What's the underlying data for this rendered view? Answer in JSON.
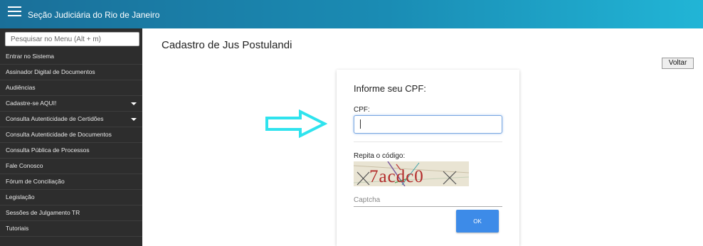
{
  "header": {
    "title": "Seção Judiciária do Rio de Janeiro",
    "menu_icon": "hamburger-icon"
  },
  "sidebar": {
    "search_placeholder": "Pesquisar no Menu (Alt + m)",
    "items": [
      {
        "label": "Entrar no Sistema",
        "has_submenu": false
      },
      {
        "label": "Assinador Digital de Documentos",
        "has_submenu": false
      },
      {
        "label": "Audiências",
        "has_submenu": false
      },
      {
        "label": "Cadastre-se AQUI!",
        "has_submenu": true
      },
      {
        "label": "Consulta Autenticidade de Certidões",
        "has_submenu": true
      },
      {
        "label": "Consulta Autenticidade de Documentos",
        "has_submenu": false
      },
      {
        "label": "Consulta Pública de Processos",
        "has_submenu": false
      },
      {
        "label": "Fale Conosco",
        "has_submenu": false
      },
      {
        "label": "Fórum de Conciliação",
        "has_submenu": false
      },
      {
        "label": "Legislação",
        "has_submenu": false
      },
      {
        "label": "Sessões de Julgamento TR",
        "has_submenu": false
      },
      {
        "label": "Tutoriais",
        "has_submenu": false
      }
    ]
  },
  "main": {
    "title": "Cadastro de Jus Postulandi",
    "back_label": "Voltar",
    "arrow_icon": "right-arrow-icon",
    "arrow_color": "#2fe3ee"
  },
  "form": {
    "heading": "Informe seu CPF:",
    "cpf_label": "CPF:",
    "cpf_value": "",
    "code_label": "Repita o código:",
    "captcha_text": "7acdc0",
    "captcha_placeholder": "Captcha",
    "ok_label": "OK"
  },
  "colors": {
    "header_start": "#1a6f99",
    "header_end": "#21b5d6",
    "sidebar_bg": "#2d2d2d",
    "ok_button": "#3d8be8"
  }
}
